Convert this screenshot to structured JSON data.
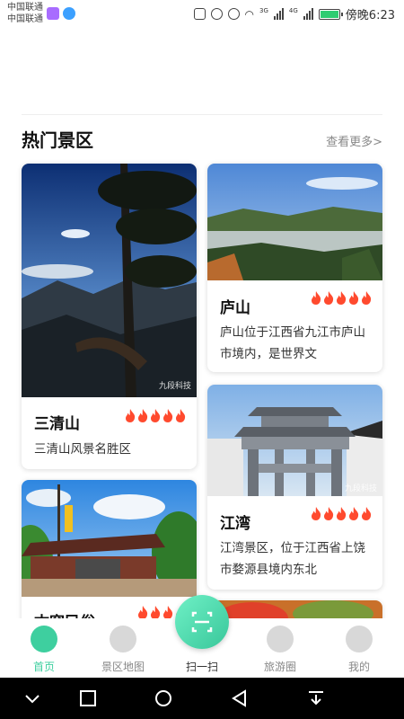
{
  "status_bar": {
    "carrier_1": "中国联通",
    "carrier_2": "中国联通",
    "net_label_1": "3G",
    "net_label_2": "4G",
    "time": "傍晚6:23",
    "battery_level": 1.0
  },
  "section": {
    "title": "热门景区",
    "more_label": "查看更多>"
  },
  "spots": [
    {
      "name": "三清山",
      "heat": 5,
      "desc": "三清山风景名胜区",
      "watermark": "九段科技"
    },
    {
      "name": "庐山",
      "heat": 5,
      "desc": "庐山位于江西省九江市庐山市境内，是世界文",
      "watermark": ""
    },
    {
      "name": "江湾",
      "heat": 5,
      "desc": "江湾景区，位于江西省上饶市婺源县境内东北",
      "watermark": "九段科技"
    },
    {
      "name": "古窑民俗",
      "heat": 4,
      "desc": "",
      "watermark": ""
    }
  ],
  "tabs": [
    {
      "label": "首页",
      "icon": "home-icon",
      "active": true
    },
    {
      "label": "景区地图",
      "icon": "map-pin-icon",
      "active": false
    },
    {
      "label": "扫一扫",
      "icon": "scan-icon",
      "active": false
    },
    {
      "label": "旅游圈",
      "icon": "compass-icon",
      "active": false
    },
    {
      "label": "我的",
      "icon": "user-icon",
      "active": false
    }
  ],
  "colors": {
    "accent": "#3ecf9f",
    "flame": "#ff4a2e"
  }
}
